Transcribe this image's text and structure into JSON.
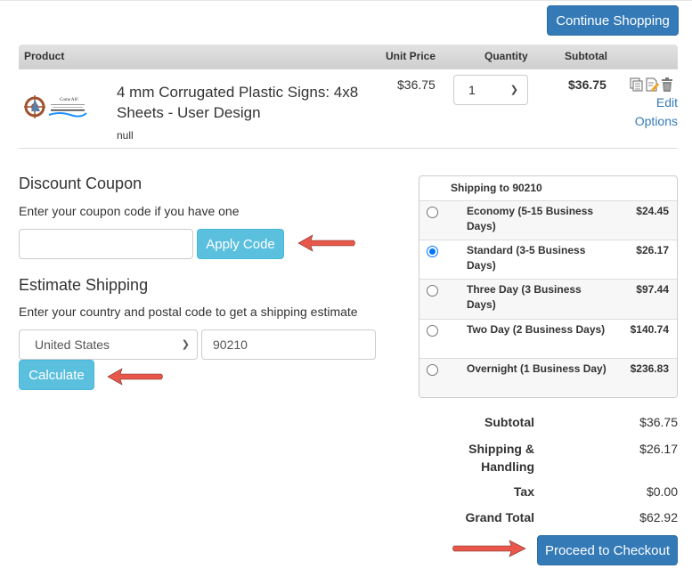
{
  "header": {
    "continue_shopping_label": "Continue Shopping"
  },
  "cart": {
    "columns": {
      "product": "Product",
      "unit_price": "Unit Price",
      "quantity": "Quantity",
      "subtotal": "Subtotal"
    },
    "items": [
      {
        "name": "4 mm Corrugated Plastic Signs: 4x8 Sheets - User Design",
        "note": "null",
        "thumbnail_text": "Come All!",
        "unit_price": "$36.75",
        "quantity": "1",
        "subtotal": "$36.75",
        "actions": {
          "copy_icon": "copy-icon",
          "edit_icon": "edit-icon",
          "delete_icon": "trash-icon",
          "edit_options_label_1": "Edit",
          "edit_options_label_2": "Options"
        }
      }
    ]
  },
  "coupon": {
    "title": "Discount Coupon",
    "help": "Enter your coupon code if you have one",
    "value": "",
    "placeholder": "",
    "apply_label": "Apply Code"
  },
  "estimate": {
    "title": "Estimate Shipping",
    "help": "Enter your country and postal code to get a shipping estimate",
    "country": "United States",
    "postal_code": "90210",
    "calculate_label": "Calculate"
  },
  "shipping": {
    "header": "Shipping to 90210",
    "options": [
      {
        "label": "Economy (5-15 Business Days)",
        "price": "$24.45",
        "selected": false
      },
      {
        "label": "Standard (3-5 Business Days)",
        "price": "$26.17",
        "selected": true
      },
      {
        "label": "Three Day (3 Business Days)",
        "price": "$97.44",
        "selected": false
      },
      {
        "label": "Two Day (2 Business Days)",
        "price": "$140.74",
        "selected": false
      },
      {
        "label": "Overnight (1 Business Day)",
        "price": "$236.83",
        "selected": false
      }
    ]
  },
  "totals": {
    "subtotal_label": "Subtotal",
    "subtotal": "$36.75",
    "shipping_label_1": "Shipping &",
    "shipping_label_2": "Handling",
    "shipping": "$26.17",
    "tax_label": "Tax",
    "tax": "$0.00",
    "grand_total_label": "Grand Total",
    "grand_total": "$62.92"
  },
  "checkout_label": "Proceed to Checkout",
  "colors": {
    "primary": "#337ab7",
    "info": "#5bc0de",
    "annotation_arrow": "#e8574a",
    "radio_selected": "#0075ff"
  }
}
